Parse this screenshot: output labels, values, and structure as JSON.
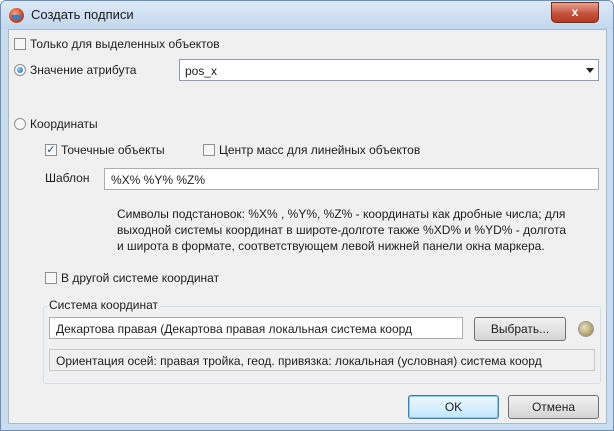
{
  "window": {
    "title": "Создать подписи",
    "close_glyph": "x"
  },
  "options": {
    "only_selected_label": "Только для выделенных объектов",
    "only_selected_checked": false,
    "attribute_value_label": "Значение атрибута",
    "attribute_value_selected": true,
    "attribute_combo_value": "pos_x",
    "coordinates_label": "Координаты",
    "coordinates_selected": false
  },
  "coordinates": {
    "point_objects_label": "Точечные объекты",
    "point_objects_checked": true,
    "mass_center_label": "Центр масс для линейных объектов",
    "mass_center_checked": false,
    "template_label": "Шаблон",
    "template_value": "%X% %Y% %Z%",
    "hint_lines": [
      "Символы подстановок: %X% , %Y%, %Z% - координаты как дробные числа; для",
      "выходной системы координат в широте-долготе также %XD% и %YD% - долгота",
      "и широта в формате, соответствующем левой нижней панели  окна маркера."
    ],
    "other_system_label": "В другой системе координат",
    "other_system_checked": false
  },
  "coord_system": {
    "group_label": "Система координат",
    "system_value": "Декартова правая (Декартова правая локальная система коорд",
    "choose_button": "Выбрать...",
    "globe_icon": "globe-icon",
    "orientation_text": "Ориентация осей: правая тройка, геод. привязка: локальная (условная) система коорд"
  },
  "footer": {
    "ok_label": "OK",
    "cancel_label": "Отмена"
  },
  "colors": {
    "accent": "#1460b8",
    "close_red": "#c5533b",
    "frame": "#c9dcf0"
  }
}
